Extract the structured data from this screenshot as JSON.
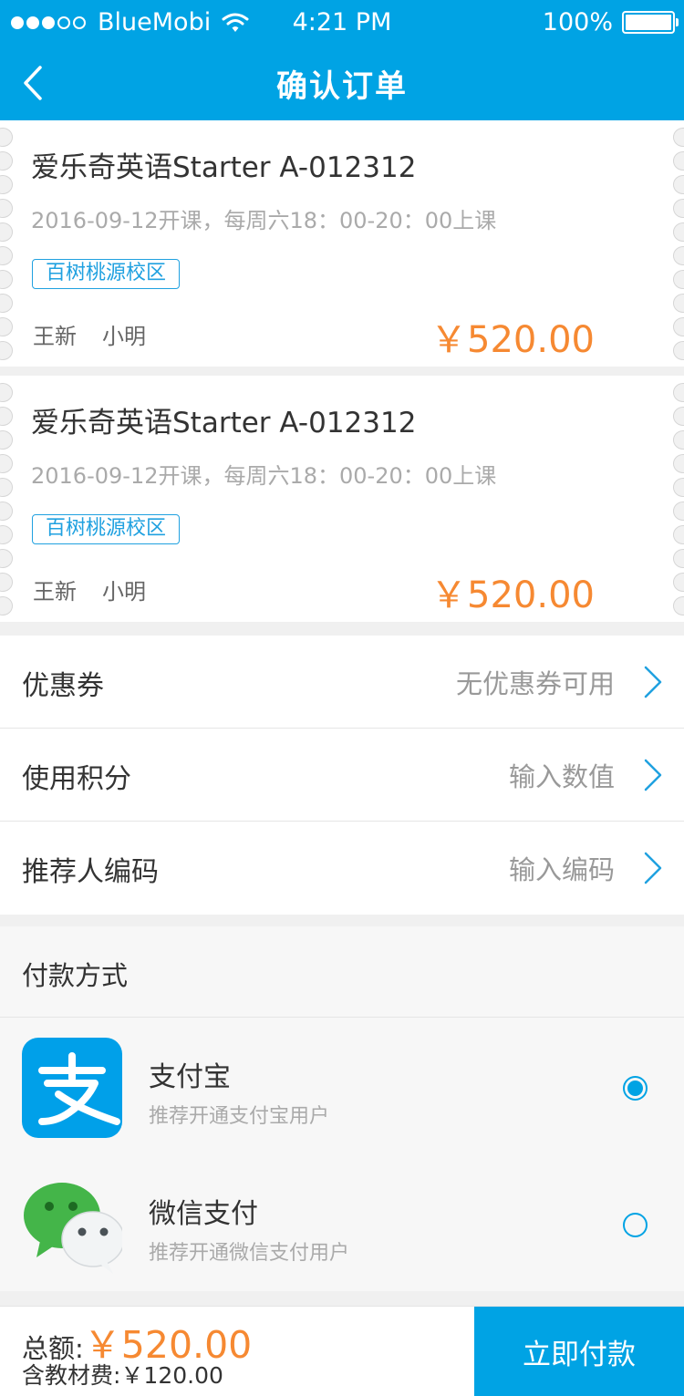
{
  "status_bar": {
    "carrier": "BlueMobi",
    "time": "4:21 PM",
    "battery": "100%",
    "signal_bars": 3,
    "signal_bars_max": 5,
    "icons": {
      "wifi": "wifi-icon",
      "battery": "battery-icon"
    }
  },
  "nav": {
    "title": "确认订单",
    "back_icon": "chevron-left-icon"
  },
  "orders": [
    {
      "course_name": "爱乐奇英语Starter A-012312",
      "schedule": "2016-09-12开课，每周六18：00-20：00上课",
      "campus": "百树桃源校区",
      "teacher": "王新",
      "student": "小明",
      "price": "￥520.00"
    },
    {
      "course_name": "爱乐奇英语Starter A-012312",
      "schedule": "2016-09-12开课，每周六18：00-20：00上课",
      "campus": "百树桃源校区",
      "teacher": "王新",
      "student": "小明",
      "price": "￥520.00"
    }
  ],
  "form": {
    "coupon": {
      "label": "优惠券",
      "value": "无优惠券可用"
    },
    "points": {
      "label": "使用积分",
      "placeholder": "输入数值"
    },
    "referrer": {
      "label": "推荐人编码",
      "placeholder": "输入编码"
    },
    "chevron_icon": "chevron-right-icon"
  },
  "payment": {
    "header": "付款方式",
    "options": [
      {
        "name": "支付宝",
        "desc": "推荐开通支付宝用户",
        "icon": "alipay-icon",
        "selected": true
      },
      {
        "name": "微信支付",
        "desc": "推荐开通微信支付用户",
        "icon": "wechat-icon",
        "selected": false
      }
    ]
  },
  "footer": {
    "total_label": "总额:",
    "total_value": "￥520.00",
    "materials": "含教材费:￥120.00",
    "pay_button": "立即付款"
  },
  "colors": {
    "primary": "#00a3e4",
    "price": "#f68932",
    "tag_border": "#20a1e0",
    "background": "#f0f0f0"
  }
}
